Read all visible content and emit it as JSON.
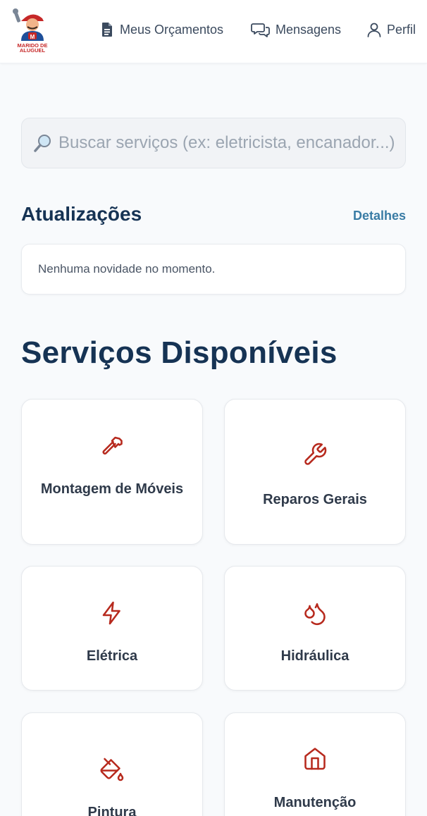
{
  "brand": {
    "logo_line1": "MARIDO DE",
    "logo_line2": "ALUGUEL",
    "logo_letter": "M"
  },
  "nav": {
    "orcamentos": {
      "label": "Meus Orçamentos",
      "icon": "document-icon"
    },
    "mensagens": {
      "label": "Mensagens",
      "icon": "chat-bubbles-icon"
    },
    "perfil": {
      "label": "Perfil",
      "icon": "user-icon"
    }
  },
  "search": {
    "placeholder": "Buscar serviços (ex: eletricista, encanador...)",
    "icon": "magnifier-icon"
  },
  "updates": {
    "title": "Atualizações",
    "link": "Detalhes",
    "empty_message": "Nenhuma novidade no momento."
  },
  "services": {
    "title": "Serviços Disponíveis",
    "items": [
      {
        "label": "Montagem de Móveis",
        "icon": "hammer-icon"
      },
      {
        "label": "Reparos Gerais",
        "icon": "wrench-icon"
      },
      {
        "label": "Elétrica",
        "icon": "lightning-icon"
      },
      {
        "label": "Hidráulica",
        "icon": "droplets-icon"
      },
      {
        "label": "Pintura",
        "icon": "paint-bucket-icon"
      },
      {
        "label": "Manutenção",
        "icon": "home-icon"
      }
    ]
  },
  "colors": {
    "accent": "#b72a1e",
    "heading": "#163354",
    "link": "#3a7ca5"
  }
}
